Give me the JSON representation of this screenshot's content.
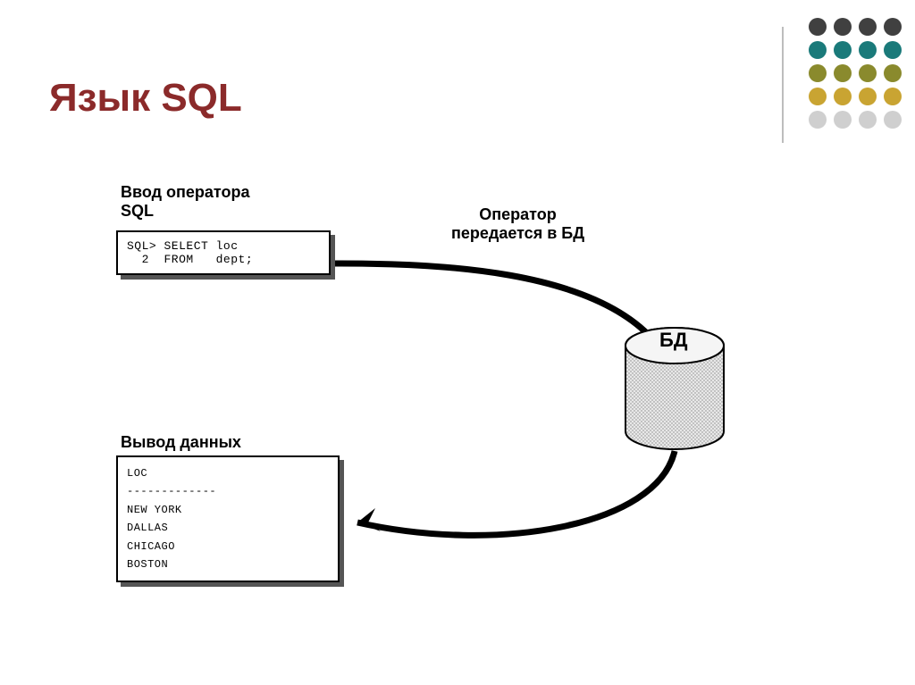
{
  "title": "Язык SQL",
  "input_box_title": "Ввод оператора\nSQL",
  "sql_input_lines": "SQL> SELECT loc\n  2  FROM   dept;",
  "arrow_caption": "Оператор\nпередается в БД",
  "db_label": "БД",
  "output_box_title": "Вывод данных",
  "output_lines": "LOC\n-------------\nNEW YORK\nDALLAS\nCHICAGO\nBOSTON",
  "dot_colors": [
    "c-dkg",
    "c-dkg",
    "c-dkg",
    "c-dkg",
    "c-teal",
    "c-teal",
    "c-teal",
    "c-teal",
    "c-olive",
    "c-olive",
    "c-olive",
    "c-olive",
    "c-gold",
    "c-gold",
    "c-gold",
    "c-gold",
    "c-lgray",
    "c-lgray",
    "c-lgray",
    "c-lgray"
  ]
}
